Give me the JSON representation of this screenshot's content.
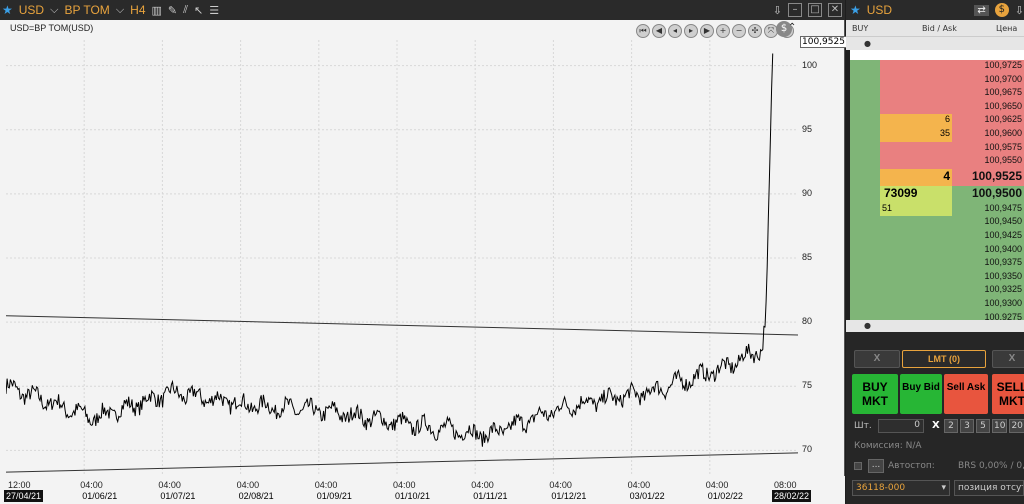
{
  "chart": {
    "titlebar": {
      "instrument": "USD",
      "board": "BP TOM",
      "timeframe": "H4"
    },
    "title": "USD=BP TOM(USD)",
    "price_flag": "100,9525",
    "chart_data": {
      "type": "line",
      "title": "USD=BP TOM(USD)",
      "x_range": [
        "27/04/21",
        "28/02/22"
      ],
      "ylim": [
        68,
        102
      ],
      "y_ticks": [
        100,
        95,
        90,
        85,
        80,
        75,
        70
      ],
      "series": [
        {
          "name": "USD=BP TOM(USD)",
          "x": [
            "27/04/21",
            "01/06/21",
            "01/07/21",
            "02/08/21",
            "01/09/21",
            "01/10/21",
            "01/11/21",
            "01/12/21",
            "03/01/22",
            "01/02/22",
            "18/02/22",
            "24/02/22",
            "28/02/22"
          ],
          "values": [
            75,
            72.5,
            74.5,
            73.5,
            73,
            72,
            71.2,
            73.5,
            74.5,
            76.5,
            78,
            81,
            100.95
          ]
        }
      ],
      "trendlines": [
        {
          "from": 80.5,
          "to": 79.0
        },
        {
          "from": 68.3,
          "to": 69.8
        }
      ]
    },
    "x_time_labels": [
      "12:00",
      "04:00",
      "04:00",
      "04:00",
      "04:00",
      "04:00",
      "04:00",
      "04:00",
      "04:00",
      "04:00",
      "08:00"
    ],
    "x_date_labels": [
      "27/04/21",
      "01/06/21",
      "01/07/21",
      "02/08/21",
      "01/09/21",
      "01/10/21",
      "01/11/21",
      "01/12/21",
      "03/01/22",
      "01/02/22",
      "28/02/22"
    ]
  },
  "book": {
    "title": "USD",
    "headers": {
      "buy": "BUY",
      "bidask": "Bid / Ask",
      "price": "Цена"
    },
    "asks": [
      {
        "vol": "",
        "price": "100,9725"
      },
      {
        "vol": "",
        "price": "100,9700"
      },
      {
        "vol": "",
        "price": "100,9675"
      },
      {
        "vol": "",
        "price": "100,9650"
      },
      {
        "vol": "6",
        "price": "100,9625"
      },
      {
        "vol": "35",
        "price": "100,9600"
      },
      {
        "vol": "",
        "price": "100,9575"
      },
      {
        "vol": "",
        "price": "100,9550"
      }
    ],
    "best_ask": {
      "vol": "4",
      "price": "100,9525"
    },
    "best_bid": {
      "vol": "73099",
      "price": "100,9500"
    },
    "bids": [
      {
        "vol": "51",
        "price": "100,9475"
      },
      {
        "vol": "",
        "price": "100,9450"
      },
      {
        "vol": "",
        "price": "100,9425"
      },
      {
        "vol": "",
        "price": "100,9400"
      },
      {
        "vol": "",
        "price": "100,9375"
      },
      {
        "vol": "",
        "price": "100,9350"
      },
      {
        "vol": "",
        "price": "100,9325"
      },
      {
        "vol": "",
        "price": "100,9300"
      },
      {
        "vol": "",
        "price": "100,9275"
      }
    ],
    "panel": {
      "cancel_left": "X",
      "lmt": "LMT (0)",
      "cancel_right": "X",
      "buy_mkt": "BUY MKT",
      "buy_bid": "Buy Bid",
      "sell_ask": "Sell Ask",
      "sell_mkt": "SELL MKT",
      "qty_label": "Шт.",
      "qty_value": "0",
      "x_label": "X",
      "multipliers": [
        "2",
        "3",
        "5",
        "10",
        "20"
      ],
      "commission": "Комиссия: N/A",
      "autostop_btn": "...",
      "autostop_label": "Автостоп:",
      "autostop_value": "BRS 0,00% / 0,",
      "account": "36118-000",
      "position_mode": "позиция отсутс"
    },
    "colors": {
      "ask": "#e98080",
      "bid": "#7fb577",
      "accent": "#e8a33d",
      "buy_btn": "#27b635",
      "sell_btn": "#e8553e"
    }
  }
}
